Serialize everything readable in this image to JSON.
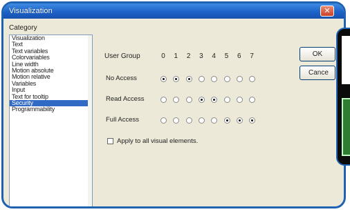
{
  "window": {
    "title": "Visualization",
    "close_glyph": "✕"
  },
  "category": {
    "label": "Category",
    "items": [
      "Visualization",
      "Text",
      "Text variables",
      "Colorvariables",
      "Line width",
      "Motion absolute",
      "Motion relative",
      "Variables",
      "Input",
      "Text for tooltip",
      "Security",
      "Programmability"
    ],
    "selected": "Security"
  },
  "security": {
    "user_group_label": "User Group",
    "groups": [
      "0",
      "1",
      "2",
      "3",
      "4",
      "5",
      "6",
      "7"
    ],
    "rows": [
      {
        "label": "No Access",
        "selected": [
          true,
          true,
          true,
          false,
          false,
          false,
          false,
          false
        ]
      },
      {
        "label": "Read Access",
        "selected": [
          false,
          false,
          false,
          true,
          true,
          false,
          false,
          false
        ]
      },
      {
        "label": "Full Access",
        "selected": [
          false,
          false,
          false,
          false,
          false,
          true,
          true,
          true
        ]
      }
    ],
    "apply_label": "Apply to all visual elements.",
    "apply_checked": false
  },
  "buttons": {
    "ok_label": "OK",
    "cancel_label": "Cance"
  },
  "colors": {
    "title_bar": "#1e63c8",
    "selection": "#316ac5",
    "frame": "#1f62b2"
  }
}
